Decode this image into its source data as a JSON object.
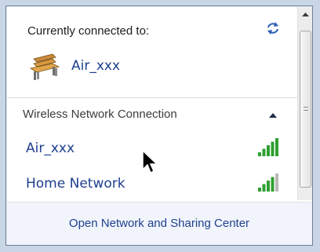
{
  "flyout": {
    "current_section": {
      "label": "Currently connected to:",
      "network_name": "Air_xxx",
      "network_icon": "bench-icon",
      "refresh_icon": "refresh-icon"
    },
    "wireless_section": {
      "title": "Wireless Network Connection",
      "collapse_icon": "chevron-up-icon",
      "networks": [
        {
          "name": "Air_xxx",
          "signal_bars": 5,
          "signal_bars_total": 5,
          "signal_color": "#2fa032"
        },
        {
          "name": "Home Network",
          "signal_bars": 4,
          "signal_bars_total": 5,
          "signal_color": "#2fa032"
        }
      ]
    },
    "footer": {
      "link_label": "Open Network and Sharing Center"
    }
  },
  "colors": {
    "link_blue": "#1e3f8f",
    "footer_bg": "#f1f5fb",
    "border": "#6f7f95"
  }
}
